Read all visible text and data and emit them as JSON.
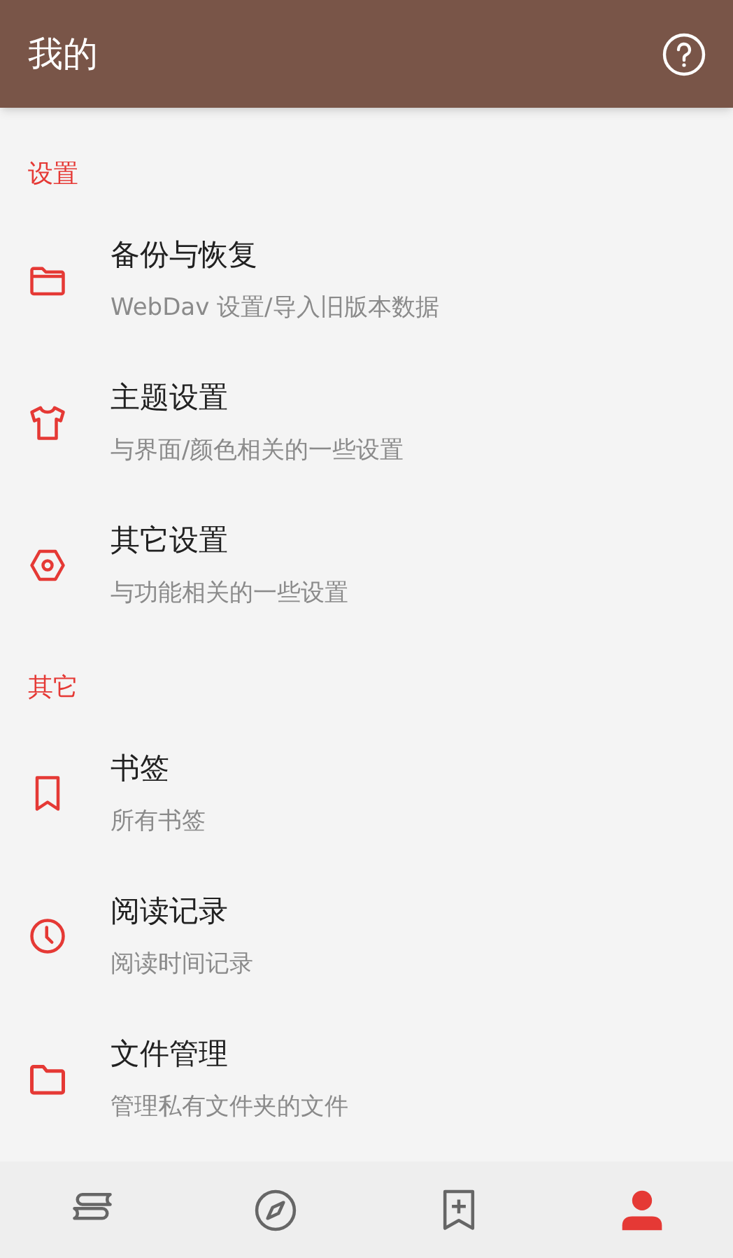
{
  "app_bar": {
    "title": "我的"
  },
  "sections": [
    {
      "label": "设置",
      "items": [
        {
          "kind": "folder-outline",
          "title": "备份与恢复",
          "subtitle": "WebDav 设置/导入旧版本数据"
        },
        {
          "kind": "shirt",
          "title": "主题设置",
          "subtitle": "与界面/颜色相关的一些设置"
        },
        {
          "kind": "hexagon",
          "title": "其它设置",
          "subtitle": "与功能相关的一些设置"
        }
      ]
    },
    {
      "label": "其它",
      "items": [
        {
          "kind": "bookmark",
          "title": "书签",
          "subtitle": "所有书签"
        },
        {
          "kind": "clock",
          "title": "阅读记录",
          "subtitle": "阅读时间记录"
        },
        {
          "kind": "folder",
          "title": "文件管理",
          "subtitle": "管理私有文件夹的文件"
        }
      ]
    }
  ],
  "bottom_nav": [
    {
      "kind": "books",
      "selected": false
    },
    {
      "kind": "compass",
      "selected": false
    },
    {
      "kind": "bookmark-add",
      "selected": false
    },
    {
      "kind": "person",
      "selected": true
    }
  ]
}
